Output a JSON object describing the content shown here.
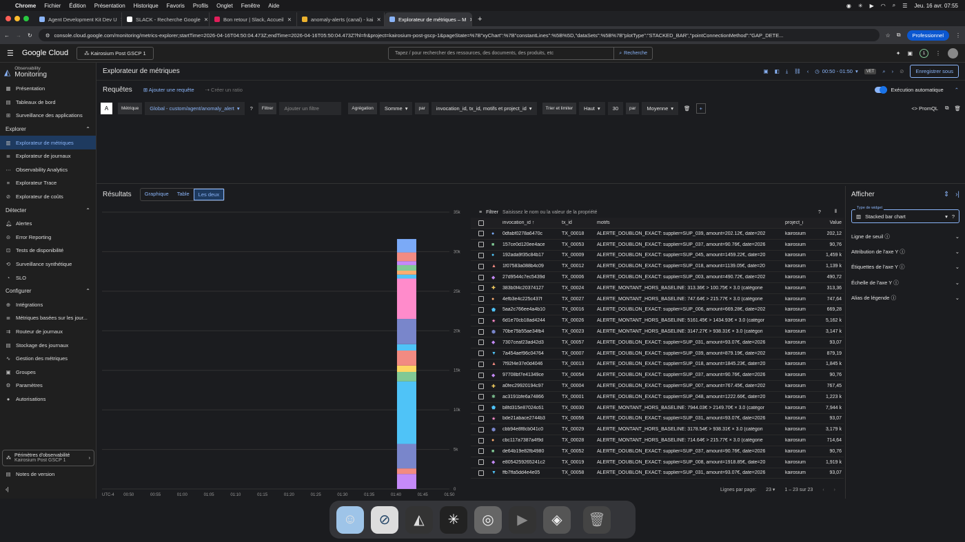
{
  "mac": {
    "apple": "",
    "app": "Chrome",
    "menus": [
      "Fichier",
      "Édition",
      "Présentation",
      "Historique",
      "Favoris",
      "Profils",
      "Onglet",
      "Fenêtre",
      "Aide"
    ],
    "clock": "Jeu. 16 avr.  07:55"
  },
  "tabs": [
    {
      "title": "Agent Development Kit Dev U"
    },
    {
      "title": "SLACK - Recherche Google"
    },
    {
      "title": "Bon retour | Slack, Accueil"
    },
    {
      "title": "anomaly-alerts (canal) - kai"
    },
    {
      "title": "Explorateur de métriques – M"
    }
  ],
  "url": "console.cloud.google.com/monitoring/metrics-explorer;startTime=2026-04-16T04:50:04.473Z;endTime=2026-04-16T05:50:04.473Z?hl=fr&project=kairosium-post-gscp-1&pageState=%7B\"xyChart\":%7B\"constantLines\":%5B%5D,\"dataSets\":%5B%7B\"plotType\":\"STACKED_BAR\",\"pointConnectionMethod\":\"GAP_DETE...",
  "profile": "Professionnel",
  "gc": {
    "logo": "Google Cloud",
    "project": "Kairosium Post GSCP 1",
    "search_placeholder": "Tapez / pour rechercher des ressources, des documents, des produits, etc",
    "search_btn": "Recherche"
  },
  "sidebar": {
    "brand_small": "Observability",
    "brand": "Monitoring",
    "top": [
      "Présentation",
      "Tableaux de bord",
      "Surveillance des applications"
    ],
    "explore_h": "Explorer",
    "explore": [
      "Explorateur de métriques",
      "Explorateur de journaux",
      "Observability Analytics",
      "Explorateur Trace",
      "Explorateur de coûts"
    ],
    "detect_h": "Détecter",
    "detect": [
      "Alertes",
      "Error Reporting",
      "Tests de disponibilité",
      "Surveillance synthétique",
      "SLO"
    ],
    "config_h": "Configurer",
    "config": [
      "Intégrations",
      "Métriques basées sur les jour...",
      "Routeur de journaux",
      "Stockage des journaux",
      "Gestion des métriques",
      "Groupes",
      "Paramètres",
      "Autorisations"
    ],
    "perim_title": "Périmètres d'observabilité",
    "perim_sub": "Kairosium Post GSCP 1",
    "notes": "Notes de version"
  },
  "page": {
    "title": "Explorateur de métriques",
    "time": "00:50 - 01:50",
    "tz": "VET",
    "save": "Enregistrer sous"
  },
  "requests": {
    "title": "Requêtes",
    "add": "Ajouter une requête",
    "ratio": "Créer un ratio",
    "auto": "Exécution automatique",
    "promql": "<> PromQL"
  },
  "query": {
    "letter": "A",
    "metric_lbl": "Métrique",
    "metric": "Global - custom/agent/anomaly_alert",
    "filter_lbl": "Filtrer",
    "filter_ph": "Ajouter un filtre",
    "agg_lbl": "Agrégation",
    "agg": "Somme",
    "par": "par",
    "groupby": "invocation_id, tx_id, motifs et project_id",
    "sort_lbl": "Trier et limiter",
    "sort": "Haut",
    "limit": "30",
    "par2": "par",
    "sortby": "Moyenne"
  },
  "results": {
    "title": "Résultats",
    "views": [
      "Graphique",
      "Table",
      "Les deux"
    ]
  },
  "chart_data": {
    "type": "bar",
    "stacked": true,
    "y_ticks": [
      "35k",
      "30k",
      "25k",
      "20k",
      "15k",
      "10k",
      "5k",
      "0"
    ],
    "x_ticks": [
      "UTC-4",
      "00:50",
      "00:55",
      "01:00",
      "01:05",
      "01:10",
      "01:15",
      "01:20",
      "01:25",
      "01:30",
      "01:35",
      "01:40",
      "01:45",
      "01:50"
    ],
    "ylim": [
      0,
      35000
    ],
    "bar_x": "01:42",
    "segments": [
      {
        "color": "#c58af9",
        "v": 1900
      },
      {
        "color": "#f28b82",
        "v": 700
      },
      {
        "color": "#7986cb",
        "v": 3100
      },
      {
        "color": "#4fc3f7",
        "v": 7900
      },
      {
        "color": "#81c995",
        "v": 1200
      },
      {
        "color": "#fdd663",
        "v": 800
      },
      {
        "color": "#f28b82",
        "v": 1900
      },
      {
        "color": "#4fc3f7",
        "v": 800
      },
      {
        "color": "#7986cb",
        "v": 3200
      },
      {
        "color": "#ff8bcb",
        "v": 5100
      },
      {
        "color": "#4fc3f7",
        "v": 500
      },
      {
        "color": "#fcad70",
        "v": 500
      },
      {
        "color": "#81c995",
        "v": 700
      },
      {
        "color": "#c58af9",
        "v": 500
      },
      {
        "color": "#f28b82",
        "v": 1100
      },
      {
        "color": "#7baaf7",
        "v": 1700
      }
    ]
  },
  "table": {
    "filter": "Filtrer",
    "filter_ph": "Saisissez le nom ou la valeur de la propriété",
    "headers": [
      "invocation_id",
      "tx_id",
      "motifs",
      "project_i",
      "Value"
    ],
    "rows": [
      [
        "0dfabf0278a6470c",
        "TX_00018",
        "ALERTE_DOUBLON_EXACT: supplier=SUP_039, amount=202.12€, date=202",
        "kairosium",
        "202,12",
        "#7baaf7"
      ],
      [
        "157ce0d120ee4ace",
        "TX_00053",
        "ALERTE_DOUBLON_EXACT: supplier=SUP_037, amount=90.76€, date=2026",
        "kairosium",
        "90,76",
        "#81c995"
      ],
      [
        "192ada9f35c84b17",
        "TX_00009",
        "ALERTE_DOUBLON_EXACT: supplier=SUP_045, amount=1459.22€, date=20",
        "kairosium",
        "1,459  k",
        "#4fc3f7"
      ],
      [
        "1f07583a088b4c09",
        "TX_00012",
        "ALERTE_DOUBLON_EXACT: supplier=SUP_018, amount=1139.05€, date=20",
        "kairosium",
        "1,139  k",
        "#f28b82"
      ],
      [
        "27d9544c7ec5439d",
        "TX_00006",
        "ALERTE_DOUBLON_EXACT: supplier=SUP_003, amount=490.72€, date=202",
        "kairosium",
        "490,72",
        "#c58af9"
      ],
      [
        "383b0f4c20374127",
        "TX_00024",
        "ALERTE_MONTANT_HORS_BASELINE: 313.36€ > 100.75€ × 3.0 (catégorie",
        "kairosium",
        "313,36",
        "#fdd663"
      ],
      [
        "4efb3e4c225c437f",
        "TX_00027",
        "ALERTE_MONTANT_HORS_BASELINE: 747.64€ > 215.77€ × 3.0 (catégorie",
        "kairosium",
        "747,64",
        "#fcad70"
      ],
      [
        "5aa2c766ee4a4b10",
        "TX_00016",
        "ALERTE_DOUBLON_EXACT: supplier=SUP_006, amount=669.28€, date=202",
        "kairosium",
        "669,28",
        "#4fc3f7"
      ],
      [
        "6d1e70cb18ad4244",
        "TX_00026",
        "ALERTE_MONTANT_HORS_BASELINE: 5161.45€ > 1434.93€ × 3.0 (catégor",
        "kairosium",
        "5,162  k",
        "#ff8bcb"
      ],
      [
        "70be75b55ae34fb4",
        "TX_00023",
        "ALERTE_MONTANT_HORS_BASELINE: 3147.27€ > 938.31€ × 3.0 (catégori",
        "kairosium",
        "3,147  k",
        "#7986cb"
      ],
      [
        "7307ceaf23ad42d3",
        "TX_00057",
        "ALERTE_DOUBLON_EXACT: supplier=SUP_031, amount=93.07€, date=2026",
        "kairosium",
        "93,07",
        "#c58af9"
      ],
      [
        "7a454aef96c04764",
        "TX_00007",
        "ALERTE_DOUBLON_EXACT: supplier=SUP_039, amount=879.19€, date=202",
        "kairosium",
        "879,19",
        "#4fc3f7"
      ],
      [
        "7f92f4e37e0d4046",
        "TX_00013",
        "ALERTE_DOUBLON_EXACT: supplier=SUP_018, amount=1845.23€, date=20",
        "kairosium",
        "1,845  k",
        "#f28b82"
      ],
      [
        "97708bf7e41349ce",
        "TX_00054",
        "ALERTE_DOUBLON_EXACT: supplier=SUP_037, amount=90.76€, date=2026",
        "kairosium",
        "90,76",
        "#c58af9"
      ],
      [
        "a0fec29920194c97",
        "TX_00004",
        "ALERTE_DOUBLON_EXACT: supplier=SUP_007, amount=767.45€, date=202",
        "kairosium",
        "767,45",
        "#fdd663"
      ],
      [
        "ac3191bfe6a74866",
        "TX_00001",
        "ALERTE_DOUBLON_EXACT: supplier=SUP_048, amount=1222.66€, date=20",
        "kairosium",
        "1,223  k",
        "#81c995"
      ],
      [
        "b8fd315e87024c61",
        "TX_00030",
        "ALERTE_MONTANT_HORS_BASELINE: 7944.03€ > 2149.70€ × 3.0 (catégor",
        "kairosium",
        "7,944  k",
        "#4fc3f7"
      ],
      [
        "bde21abace2744b3",
        "TX_00056",
        "ALERTE_DOUBLON_EXACT: supplier=SUP_031, amount=93.07€, date=2026",
        "kairosium",
        "93,07",
        "#ff8bcb"
      ],
      [
        "cbb94e8f8cb041c0",
        "TX_00029",
        "ALERTE_MONTANT_HORS_BASELINE: 3178.54€ > 938.31€ × 3.0 (catégori",
        "kairosium",
        "3,179  k",
        "#7986cb"
      ],
      [
        "cbc117a7387a4f9d",
        "TX_00028",
        "ALERTE_MONTANT_HORS_BASELINE: 714.64€ > 215.77€ × 3.0 (catégorie",
        "kairosium",
        "714,64",
        "#fcad70"
      ],
      [
        "de64b19e82fb4980",
        "TX_00052",
        "ALERTE_DOUBLON_EXACT: supplier=SUP_037, amount=90.76€, date=2026",
        "kairosium",
        "90,76",
        "#81c995"
      ],
      [
        "e8054259265241c2",
        "TX_00019",
        "ALERTE_DOUBLON_EXACT: supplier=SUP_008, amount=1918.85€, date=20",
        "kairosium",
        "1,919  k",
        "#c58af9"
      ],
      [
        "ffb7ffa5dd4e4e05",
        "TX_00058",
        "ALERTE_DOUBLON_EXACT: supplier=SUP_031, amount=93.07€, date=2026",
        "kairosium",
        "93,07",
        "#4fc3f7"
      ]
    ],
    "rows_label": "Lignes par page:",
    "rows_per_page": "23",
    "range": "1 – 23 sur 23"
  },
  "panel": {
    "title": "Afficher",
    "widget_cap": "Type de widget",
    "widget": "Stacked bar chart",
    "sections": [
      "Ligne de seuil",
      "Attribution de l'axe Y",
      "Étiquettes de l'axe Y",
      "Échelle de l'axe Y",
      "Alias de légende"
    ]
  }
}
